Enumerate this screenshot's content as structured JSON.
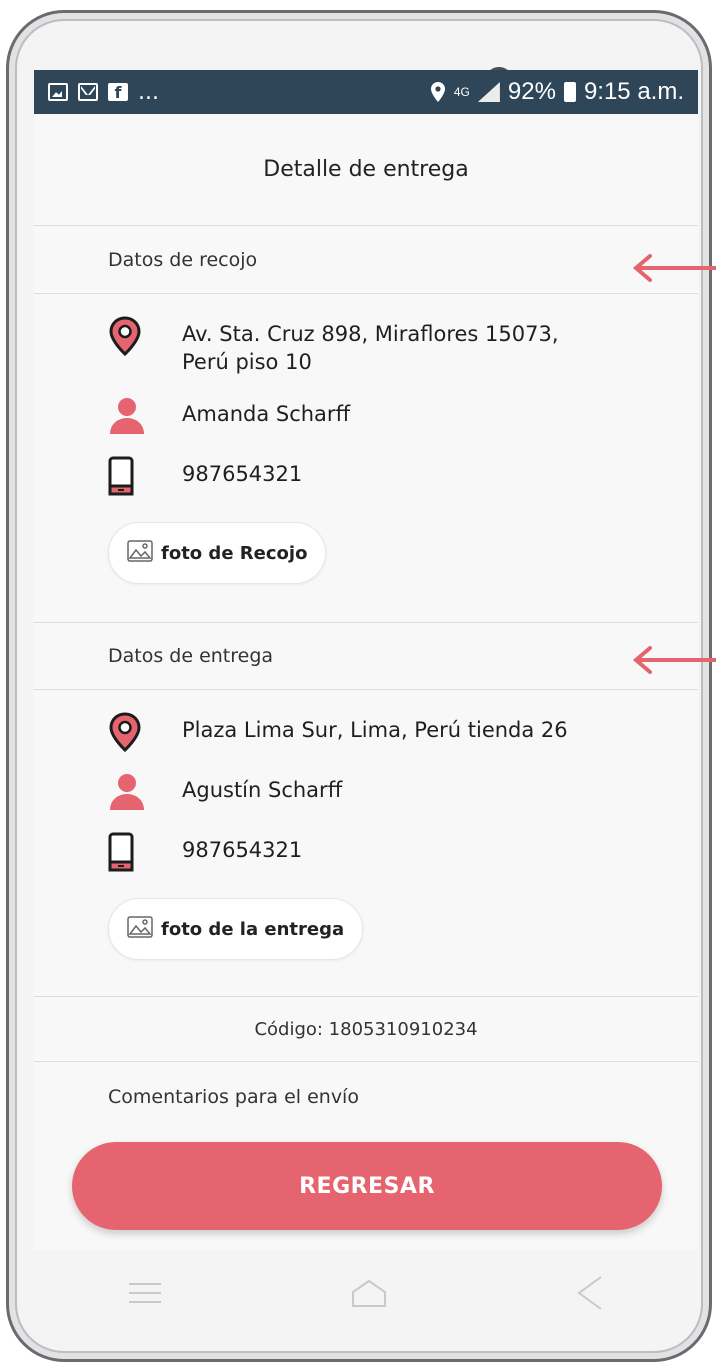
{
  "status_bar": {
    "ellipsis": "...",
    "network": "4G",
    "battery": "92%",
    "time": "9:15 a.m."
  },
  "header": {
    "title": "Detalle de entrega"
  },
  "pickup": {
    "section_title": "Datos de recojo",
    "address": "Av. Sta. Cruz 898, Miraflores 15073,\nPerú piso 10",
    "name": "Amanda Scharff",
    "phone": "987654321",
    "photo_button": "foto de Recojo"
  },
  "delivery": {
    "section_title": "Datos de entrega",
    "address": "Plaza Lima Sur, Lima, Perú tienda 26",
    "name": "Agustín Scharff",
    "phone": "987654321",
    "photo_button": "foto de la entrega"
  },
  "code": "Código: 1805310910234",
  "comments_label": "Comentarios para el envío",
  "back_button": "REGRESAR",
  "colors": {
    "accent": "#e6646f",
    "status_bar": "#2f4558",
    "annotation_arrow": "#e6646f"
  },
  "icons": [
    "location-pin-icon",
    "person-icon",
    "mobile-phone-icon",
    "image-icon",
    "menu-icon",
    "home-icon",
    "back-icon",
    "arrow-left-icon"
  ]
}
